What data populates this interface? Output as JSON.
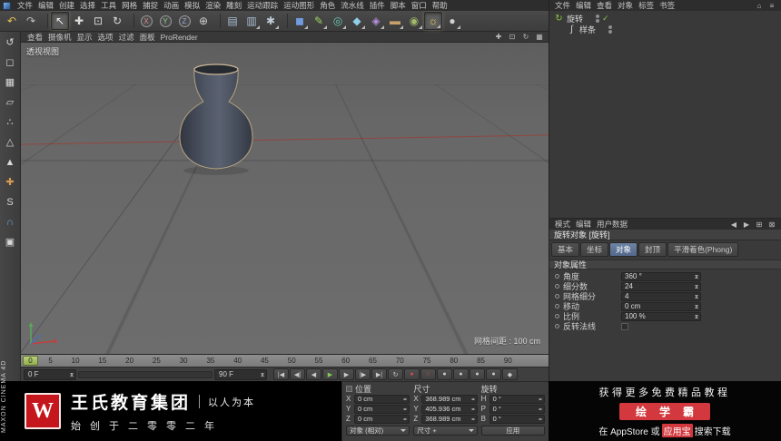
{
  "app": {
    "menubar": [
      "文件",
      "编辑",
      "创建",
      "选择",
      "工具",
      "网格",
      "捕捉",
      "动画",
      "模拟",
      "渲染",
      "雕刻",
      "运动跟踪",
      "运动图形",
      "角色",
      "流水线",
      "插件",
      "脚本",
      "窗口",
      "帮助"
    ]
  },
  "toolbar": {
    "icons": [
      {
        "name": "undo-icon",
        "glyph": "↶",
        "color": "#e5c14d"
      },
      {
        "name": "redo-icon",
        "glyph": "↷",
        "color": "#bdbdbd"
      },
      {
        "name": "toolbar-separator",
        "sep": true
      },
      {
        "name": "live-selection-icon",
        "glyph": "↖",
        "color": "#efefef",
        "active": true
      },
      {
        "name": "move-icon",
        "glyph": "✚",
        "color": "#dcdcdc"
      },
      {
        "name": "scale-icon",
        "glyph": "⊡",
        "color": "#dcdcdc"
      },
      {
        "name": "rotate-icon",
        "glyph": "↻",
        "color": "#dcdcdc"
      },
      {
        "name": "toolbar-separator",
        "sep": true
      },
      {
        "name": "x-lock-icon",
        "glyph": "X",
        "round": true,
        "color": "#e08a8a"
      },
      {
        "name": "y-lock-icon",
        "glyph": "Y",
        "round": true,
        "color": "#93d093"
      },
      {
        "name": "z-lock-icon",
        "glyph": "Z",
        "round": true,
        "color": "#8fa9e0"
      },
      {
        "name": "coordinate-system-icon",
        "glyph": "⊕",
        "color": "#cfcfcf"
      },
      {
        "name": "toolbar-separator",
        "sep": true
      },
      {
        "name": "render-view-icon",
        "glyph": "▤",
        "color": "#a9bfd2"
      },
      {
        "name": "render-picture-viewer-icon",
        "glyph": "▥",
        "color": "#a9bfd2",
        "caret": true
      },
      {
        "name": "render-settings-icon",
        "glyph": "✱",
        "color": "#bfcbd6",
        "caret": true
      },
      {
        "name": "toolbar-separator",
        "sep": true
      },
      {
        "name": "add-cube-icon",
        "glyph": "◼",
        "color": "#6f9ce0",
        "caret": true
      },
      {
        "name": "add-spline-icon",
        "glyph": "✎",
        "color": "#9cd05e",
        "caret": true
      },
      {
        "name": "add-generator-icon",
        "glyph": "◎",
        "color": "#67c6b2",
        "caret": true
      },
      {
        "name": "add-modeling-icon",
        "glyph": "◆",
        "color": "#8fd0e8",
        "caret": true
      },
      {
        "name": "add-deformer-icon",
        "glyph": "◈",
        "color": "#b78ee0",
        "caret": true
      },
      {
        "name": "add-environment-icon",
        "glyph": "▬",
        "color": "#c8a06a",
        "caret": true
      },
      {
        "name": "add-camera-icon",
        "glyph": "◉",
        "color": "#9fb86a",
        "caret": true
      },
      {
        "name": "add-light-icon",
        "glyph": "☼",
        "color": "#f0d060",
        "caret": true,
        "active": true
      },
      {
        "name": "add-material-icon",
        "glyph": "●",
        "color": "#d0d0d0",
        "caret": true
      }
    ]
  },
  "palette": {
    "icons": [
      {
        "name": "make-editable-icon",
        "glyph": "↺",
        "color": "#d8d8d8"
      },
      {
        "name": "model-mode-icon",
        "glyph": "◻",
        "color": "#d8d8d8"
      },
      {
        "name": "texture-mode-icon",
        "glyph": "▦",
        "color": "#d8d8d8"
      },
      {
        "name": "workplane-mode-icon",
        "glyph": "▱",
        "color": "#d8d8d8"
      },
      {
        "name": "points-mode-icon",
        "glyph": "∴",
        "color": "#d8d8d8"
      },
      {
        "name": "edges-mode-icon",
        "glyph": "△",
        "color": "#d8d8d8"
      },
      {
        "name": "polygons-mode-icon",
        "glyph": "▲",
        "color": "#d8d8d8"
      },
      {
        "name": "axis-mode-icon",
        "glyph": "✚",
        "color": "#d89a50"
      },
      {
        "name": "solo-mode-icon",
        "glyph": "S",
        "color": "#d8d8d8"
      },
      {
        "name": "snap-icon",
        "glyph": "∩",
        "color": "#6fa8dc"
      },
      {
        "name": "lock-workplane-icon",
        "glyph": "▣",
        "color": "#d8d8d8"
      }
    ]
  },
  "viewport": {
    "menu": [
      "查看",
      "摄像机",
      "显示",
      "选项",
      "过滤",
      "面板",
      "ProRender"
    ],
    "nav_icons": [
      {
        "name": "pan-view-icon",
        "glyph": "✚"
      },
      {
        "name": "zoom-view-icon",
        "glyph": "⊡"
      },
      {
        "name": "rotate-view-icon",
        "glyph": "↻"
      },
      {
        "name": "toggle-view-icon",
        "glyph": "▦"
      }
    ],
    "label": "透视视图",
    "grid_label": "网格间距 : 100 cm"
  },
  "object_manager": {
    "menu": [
      "文件",
      "编辑",
      "查看",
      "对象",
      "标签",
      "书签"
    ],
    "right_icons": [
      {
        "name": "om-home-icon",
        "glyph": "⌂"
      },
      {
        "name": "om-menu-icon",
        "glyph": "≡"
      }
    ],
    "rows": [
      {
        "name": "旋转",
        "icon": "↻"
      },
      {
        "name": "样条",
        "icon": "∫"
      }
    ]
  },
  "attributes": {
    "menu": [
      "模式",
      "编辑",
      "用户数据"
    ],
    "right_icons": [
      {
        "name": "am-back-icon",
        "glyph": "◀"
      },
      {
        "name": "am-forward-icon",
        "glyph": "▶"
      },
      {
        "name": "am-panel-icon",
        "glyph": "⊞"
      },
      {
        "name": "am-lock-icon",
        "glyph": "⊠"
      }
    ],
    "title": "旋转对象 [旋转]",
    "tabs": [
      {
        "label": "基本"
      },
      {
        "label": "坐标"
      },
      {
        "label": "对象",
        "active": true
      },
      {
        "label": "封顶"
      },
      {
        "label": "平滑着色(Phong)"
      }
    ],
    "section": "对象属性",
    "props": [
      {
        "label": "角度",
        "value": "360 °"
      },
      {
        "label": "细分数",
        "value": "24"
      },
      {
        "label": "网格细分",
        "value": "4"
      },
      {
        "label": "移动",
        "value": "0 cm"
      },
      {
        "label": "比例",
        "value": "100 %"
      },
      {
        "label": "反转法线",
        "value": "",
        "checkbox": true
      }
    ]
  },
  "timeline": {
    "ticks": [
      "0",
      "5",
      "10",
      "15",
      "20",
      "25",
      "30",
      "35",
      "40",
      "45",
      "50",
      "55",
      "60",
      "65",
      "70",
      "75",
      "80",
      "85",
      "90"
    ],
    "handle": "0",
    "start_field": "0 F",
    "end_field": "90 F"
  },
  "playback": {
    "buttons": [
      {
        "name": "goto-start-button",
        "glyph": "|◀"
      },
      {
        "name": "prev-key-button",
        "glyph": "◀|"
      },
      {
        "name": "prev-frame-button",
        "glyph": "◀"
      },
      {
        "name": "play-button",
        "glyph": "▶",
        "color": "#86c855"
      },
      {
        "name": "next-frame-button",
        "glyph": "▶"
      },
      {
        "name": "next-key-button",
        "glyph": "|▶"
      },
      {
        "name": "goto-end-button",
        "glyph": "▶|"
      },
      {
        "name": "loop-button",
        "glyph": "↻"
      },
      {
        "name": "record-keyframe-button",
        "glyph": "●",
        "color": "#d84a4a"
      },
      {
        "name": "autokey-button",
        "glyph": "○",
        "color": "#d84a4a"
      },
      {
        "name": "record-position-button",
        "glyph": "●",
        "color": "#c9c9c9"
      },
      {
        "name": "record-scale-button",
        "glyph": "●",
        "color": "#c9c9c9"
      },
      {
        "name": "record-rotation-button",
        "glyph": "●",
        "color": "#c9c9c9"
      },
      {
        "name": "record-parameter-button",
        "glyph": "●",
        "color": "#c9c9c9"
      },
      {
        "name": "keyframe-selection-button",
        "glyph": "◆",
        "color": "#c9c9c9"
      }
    ]
  },
  "coordinates": {
    "position": {
      "title": "位置",
      "rows": [
        {
          "axis": "X",
          "value": "0 cm"
        },
        {
          "axis": "Y",
          "value": "0 cm"
        },
        {
          "axis": "Z",
          "value": "0 cm"
        }
      ]
    },
    "size": {
      "title": "尺寸",
      "rows": [
        {
          "axis": "X",
          "value": "368.989 cm"
        },
        {
          "axis": "Y",
          "value": "405.936 cm"
        },
        {
          "axis": "Z",
          "value": "368.989 cm"
        }
      ]
    },
    "rotation": {
      "title": "旋转",
      "rows": [
        {
          "axis": "H",
          "value": "0 °"
        },
        {
          "axis": "P",
          "value": "0 °"
        },
        {
          "axis": "B",
          "value": "0 °"
        }
      ]
    },
    "mode_dropdown": "对象 (相对)",
    "size_dropdown": "尺寸 +",
    "apply_label": "应用"
  },
  "branding": {
    "vertical_label": "MAXON CINEMA 4D"
  },
  "banner_left": {
    "logo_letter": "W",
    "title": "王氏教育集团",
    "slogan": "以人为本",
    "line2": "始创于二零零二年"
  },
  "banner_right": {
    "line1": "获得更多免费精品教程",
    "badge": "绘学霸",
    "line3_a": "在 AppStore 或",
    "line3_b": "应用宝",
    "line3_c": "搜索下载"
  }
}
